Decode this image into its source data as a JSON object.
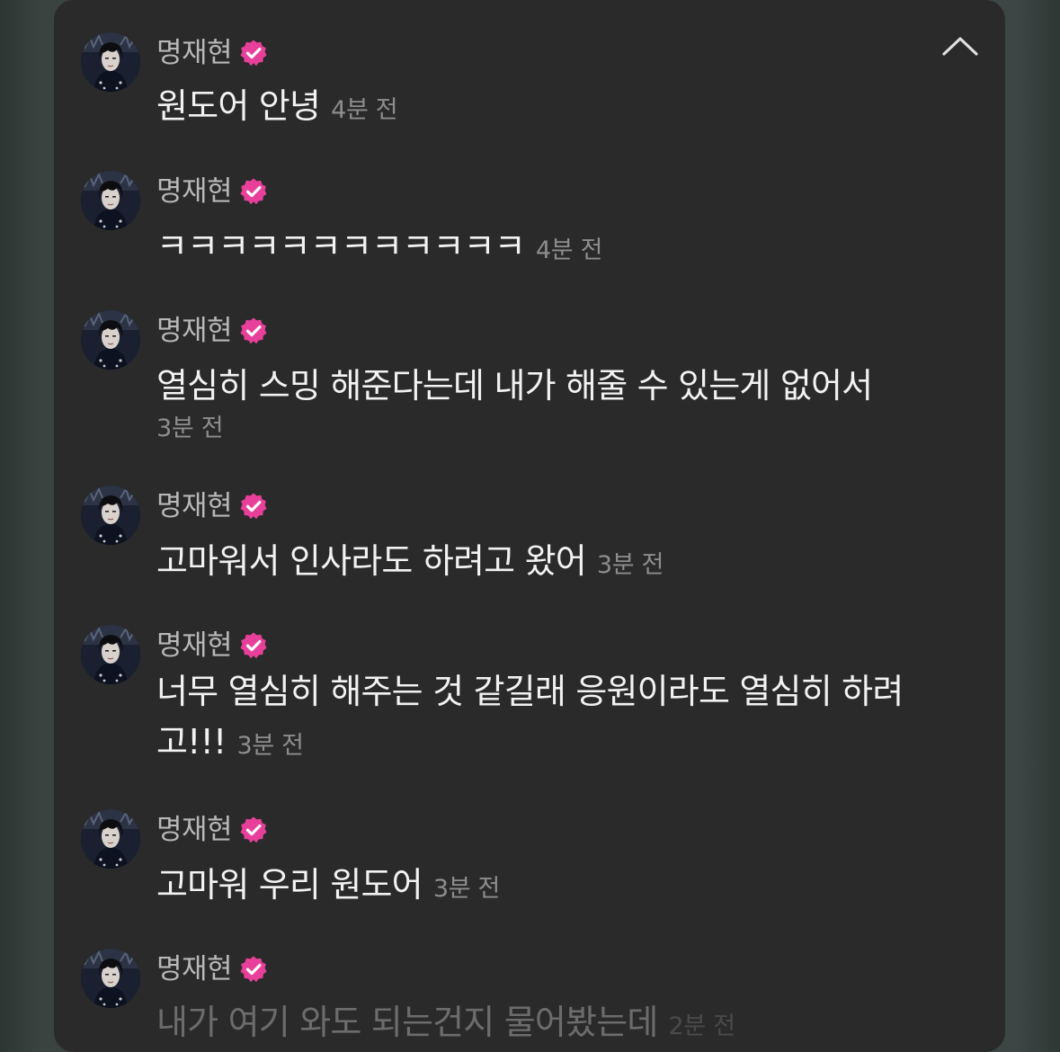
{
  "user": {
    "name": "명재현"
  },
  "messages": [
    {
      "text": "원도어 안녕",
      "time": "4분 전"
    },
    {
      "text": "ㅋㅋㅋㅋㅋㅋㅋㅋㅋㅋㅋㅋ",
      "time": "4분 전"
    },
    {
      "text": "열심히 스밍 해준다는데 내가 해줄 수 있는게 없어서",
      "time": "3분 전"
    },
    {
      "text": "고마워서 인사라도 하려고 왔어",
      "time": "3분 전"
    },
    {
      "text": "너무 열심히 해주는 것 같길래 응원이라도 열심히 하려고!!!",
      "time": "3분 전"
    },
    {
      "text": "고마워 우리 원도어",
      "time": "3분 전"
    },
    {
      "text": "내가 여기 와도 되는건지 물어봤는데",
      "time": "2분 전"
    }
  ],
  "icons": {
    "collapse": "chevron-up-icon",
    "verified": "verified-badge-icon"
  },
  "colors": {
    "panel_background": "#2a2a2a",
    "verified_badge": "#e8409a",
    "message_text": "#f2f2f2",
    "timestamp_text": "#8d8d8d",
    "name_text": "#b8b8b8"
  }
}
